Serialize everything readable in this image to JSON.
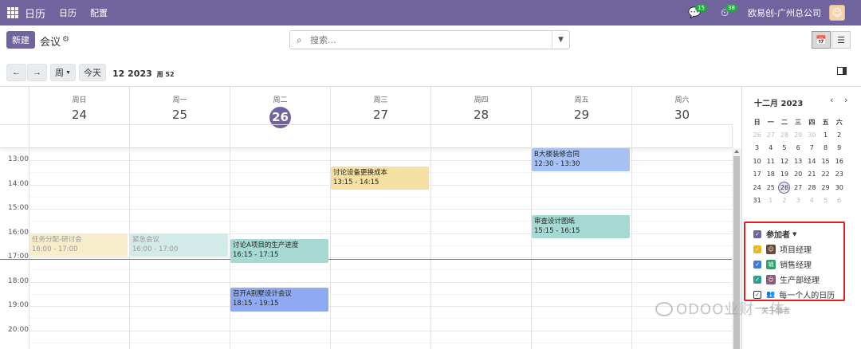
{
  "navbar": {
    "brand": "日历",
    "menu": [
      "日历",
      "配置"
    ],
    "messages_badge": "15",
    "activity_badge": "38",
    "company": "欧易创-广州总公司"
  },
  "control": {
    "new_label": "新建",
    "title": "会议",
    "search_placeholder": "搜索..."
  },
  "toolbar": {
    "prev": "←",
    "next": "→",
    "scale": "周",
    "today": "今天",
    "range": "12 2023",
    "week": "周 52"
  },
  "calendar": {
    "days": [
      {
        "name": "周日",
        "num": "24"
      },
      {
        "name": "周一",
        "num": "25"
      },
      {
        "name": "周二",
        "num": "26",
        "today": true
      },
      {
        "name": "周三",
        "num": "27"
      },
      {
        "name": "周四",
        "num": "28"
      },
      {
        "name": "周五",
        "num": "29"
      },
      {
        "name": "周六",
        "num": "30"
      }
    ],
    "hours": [
      "13:00",
      "14:00",
      "15:00",
      "16:00",
      "17:00",
      "18:00",
      "19:00",
      "20:00"
    ],
    "events": [
      {
        "title": "B大楼装修合同",
        "time": "12:30 - 13:30",
        "color": "#a6c1f2"
      },
      {
        "title": "讨论设备更换成本",
        "time": "13:15 - 14:15",
        "color": "#f5dfa1"
      },
      {
        "title": "审查设计图纸",
        "time": "15:15 - 16:15",
        "color": "#a5d9d2"
      },
      {
        "title": "任务分配-研讨会",
        "time": "16:00 - 17:00",
        "color": "#f8edcb"
      },
      {
        "title": "紧急会议",
        "time": "16:00 - 17:00",
        "color": "#d3ebe8"
      },
      {
        "title": "讨论A项目的生产进度",
        "time": "16:15 - 17:15",
        "color": "#a5d9d2"
      },
      {
        "title": "召开A别墅设计会议",
        "time": "18:15 - 19:15",
        "color": "#8faaf2"
      }
    ]
  },
  "sidebar": {
    "month_title": "十二月 2023",
    "weekdays": [
      "日",
      "一",
      "二",
      "三",
      "四",
      "五",
      "六"
    ],
    "weeks": [
      [
        "26",
        "27",
        "28",
        "29",
        "30",
        "1",
        "2"
      ],
      [
        "3",
        "4",
        "5",
        "6",
        "7",
        "8",
        "9"
      ],
      [
        "10",
        "11",
        "12",
        "13",
        "14",
        "15",
        "16"
      ],
      [
        "17",
        "18",
        "19",
        "20",
        "21",
        "22",
        "23"
      ],
      [
        "24",
        "25",
        "26",
        "27",
        "28",
        "29",
        "30"
      ],
      [
        "31",
        "1",
        "2",
        "3",
        "4",
        "5",
        "6"
      ]
    ],
    "filter_title": "参加者",
    "attendees": [
      {
        "name": "项目经理",
        "color": "#e8b923"
      },
      {
        "name": "销售经理",
        "color": "#3b7dd8"
      },
      {
        "name": "生产部经理",
        "color": "#2f9e8f"
      }
    ],
    "everyone": "每一个人的日历",
    "more": "关于加者"
  },
  "watermark": "ODOO业财一体"
}
